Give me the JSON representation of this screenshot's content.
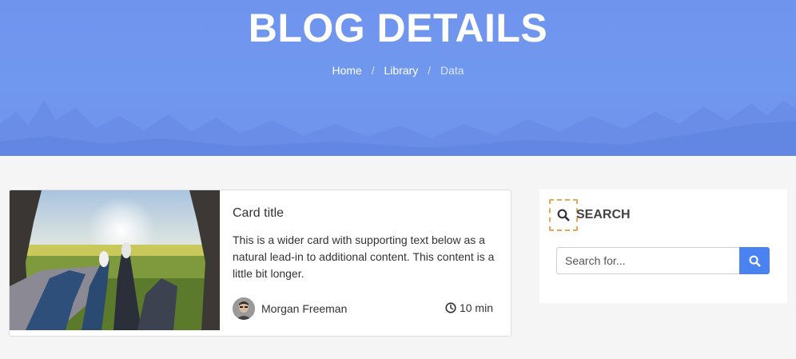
{
  "hero": {
    "title": "BLOG DETAILS",
    "background_color": "#7098ee"
  },
  "breadcrumb": {
    "items": [
      "Home",
      "Library",
      "Data"
    ],
    "separator": "/"
  },
  "card": {
    "title": "Card title",
    "text": "This is a wider card with supporting text below as a natural lead-in to additional content. This content is a little bit longer.",
    "author": "Morgan Freeman",
    "read_time": "10 min",
    "image_alt": "two people lying in a car trunk watching the sunset over a field"
  },
  "search_widget": {
    "icon": "search-icon",
    "title": "SEARCH",
    "placeholder": "Search for...",
    "button_icon": "search-icon",
    "accent_color": "#4a82f1",
    "highlight_color": "#f0a450"
  }
}
